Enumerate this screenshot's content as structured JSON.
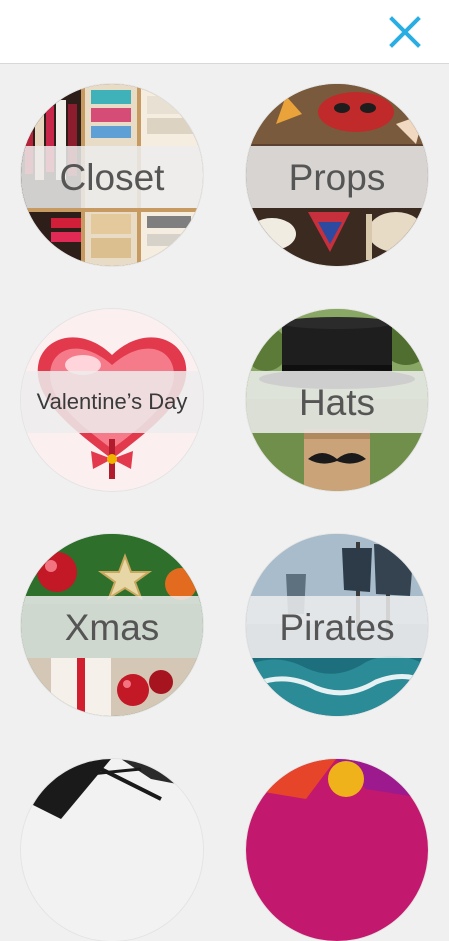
{
  "header": {
    "close_icon": "close-icon",
    "accent_color": "#29aee3"
  },
  "categories": [
    {
      "label": "Closet"
    },
    {
      "label": "Props"
    },
    {
      "label": "Valentine’s Day"
    },
    {
      "label": "Hats"
    },
    {
      "label": "Xmas"
    },
    {
      "label": "Pirates"
    }
  ]
}
